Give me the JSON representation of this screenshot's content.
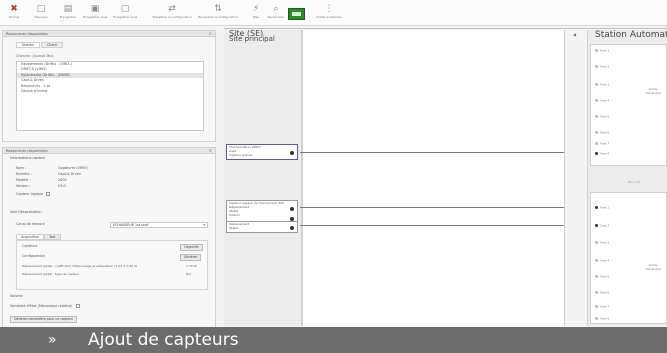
{
  "toolbar": {
    "buttons": [
      {
        "icon": "close-icon",
        "glyph": "✖",
        "label": "Fermer"
      },
      {
        "icon": "new-icon",
        "glyph": "□",
        "label": "Nouveau"
      },
      {
        "icon": "open-icon",
        "glyph": "▤",
        "label": "Enregistrer"
      },
      {
        "icon": "save-icon",
        "glyph": "▣",
        "label": "Enregistrer sous"
      },
      {
        "icon": "save-as-icon",
        "glyph": "▢",
        "label": "Enregistrer sous"
      },
      {
        "icon": "transfer-icon",
        "glyph": "⇄",
        "label": "Transférer la configuration"
      },
      {
        "icon": "receive-icon",
        "glyph": "⇅",
        "label": "Récupérer la configuration"
      },
      {
        "icon": "power-icon",
        "glyph": "⚡",
        "label": "Mes"
      },
      {
        "icon": "search-icon",
        "glyph": "⌕",
        "label": "Rechercher"
      }
    ],
    "accent": "#2e8b2e",
    "extra_label": "Outils auxiliaires"
  },
  "library_panel": {
    "title": "Ressources disponibles",
    "tabs": [
      "Station",
      "Client"
    ],
    "filter": "Cherche: (Journal Mix)",
    "items": [
      {
        "label": "Equipements (Drifts) - (1983-)"
      },
      {
        "label": "DRIFT-E (VIMO)"
      },
      {
        "label": "Nylontracke (Drifts) - (DWIIE)",
        "selected": true
      },
      {
        "label": "Capt.& Drven"
      },
      {
        "label": "Ressources - 1 sil"
      },
      {
        "label": "Disque d'Invest"
      }
    ]
  },
  "props_panel": {
    "title": "Ressources disponibles",
    "section_info": "Informations capteur",
    "fields": [
      {
        "label": "Nom :",
        "value": "Gapteurre (VIMO)"
      },
      {
        "label": "Numéro :",
        "value": "Capt.& Drven"
      },
      {
        "label": "Modèle :",
        "value": "2400"
      },
      {
        "label": "Version :",
        "value": "V3.0"
      }
    ],
    "capteur_logique": "Capteur logique",
    "section_measure": "Voie Désactivation",
    "measure_label": "Canal de mesure",
    "measure_value": "ECHANGEUR 1st stuff",
    "subtabs": [
      "Acquisition",
      "Test"
    ],
    "inner": [
      {
        "label": "Capteurs",
        "btn": "Objectifs"
      },
      {
        "label": "Configuration",
        "btn": "Générer"
      },
      {
        "label": "Déplacement global : coefficient d'étalonnage et adéquation (1,53 ± 0,50 V)",
        "val": "1,70 W"
      },
      {
        "label": "Déplacement global : type de capteur",
        "val": "Rel"
      }
    ],
    "section_state": "Volume",
    "state_row": "Variables d'état (Mécanique relative)",
    "footer_btn": "Générer paramètre pour ce capteur"
  },
  "canvas": {
    "title": "Site (SE)",
    "subtitle": "Site principal",
    "collapse_glyph": "◀"
  },
  "signals": [
    {
      "lines": [
        "Thermomètre (VIMO)",
        "Capt",
        "Capteur lecture"
      ]
    },
    {
      "lines": [
        "Capteur logique de mouvement (SE)",
        "Déplacement",
        "Statut",
        "Aditum"
      ]
    },
    {
      "lines": [
        "Déplacement",
        "Statut"
      ]
    }
  ],
  "station": {
    "title": "Station Automatique",
    "ports_top": [
      "Voie 1",
      "Voie 2",
      "Voie 3",
      "Voie 4",
      "Voie 5",
      "Voie 6",
      "Voie 7",
      "Voie 8"
    ],
    "node_top": "Sortie numérique",
    "sep_label": "Bloc 1/2",
    "ports_bottom": [
      "Voie 1",
      "Voie 2",
      "Voie 3",
      "Voie 4",
      "Voie 5",
      "Voie 6",
      "Voie 7",
      "Voie 8"
    ],
    "node_bottom": "Sortie numérique"
  },
  "footer": {
    "chevron": "»",
    "caption": "Ajout de capteurs"
  }
}
